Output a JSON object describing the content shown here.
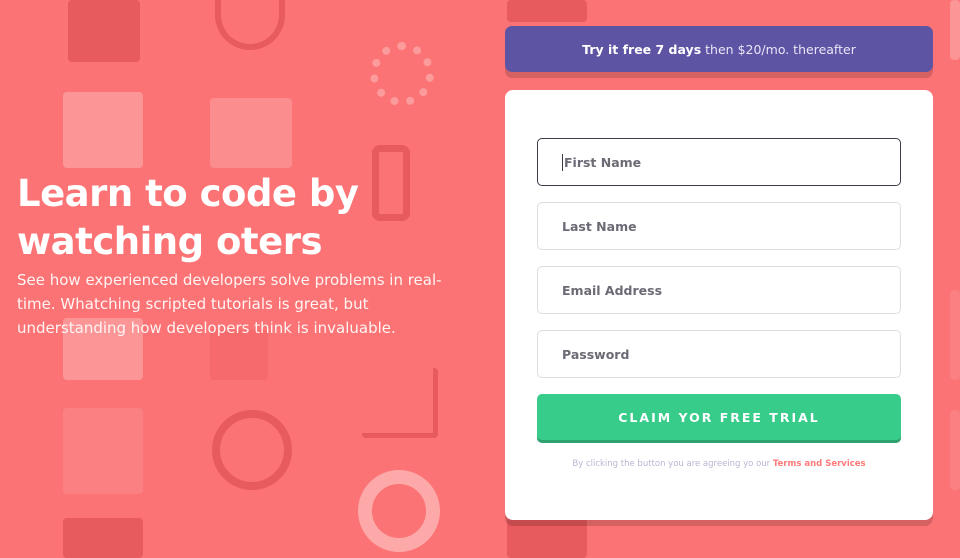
{
  "colors": {
    "background": "#fb7374",
    "promo_banner": "#5e54a4",
    "cta": "#38cc8b",
    "terms_link": "#ff7a7a"
  },
  "hero": {
    "title": "Learn to code by watching oters",
    "description": "See how experienced developers solve problems in real-time. Whatching scripted tutorials is great, but understanding how developers think is invaluable."
  },
  "promo": {
    "bold": "Try it free 7 days",
    "rest": "then $20/mo. thereafter"
  },
  "form": {
    "first_name_placeholder": "First Name",
    "last_name_placeholder": "Last Name",
    "email_placeholder": "Email Address",
    "password_placeholder": "Password",
    "submit_label": "CLAIM YOR FREE TRIAL",
    "terms_text": "By clicking the button you are agreeing yo our",
    "terms_link": "Terms and Services"
  },
  "background_icons": [
    "toolbox-icon",
    "headset-icon",
    "network-icon",
    "puzzle-icon",
    "thumbs-up-icon",
    "phone-icon",
    "magnifier-icon",
    "pencil-icon",
    "cart-icon",
    "key-icon",
    "globe-icon",
    "lifebuoy-icon",
    "browser-window-icon"
  ]
}
